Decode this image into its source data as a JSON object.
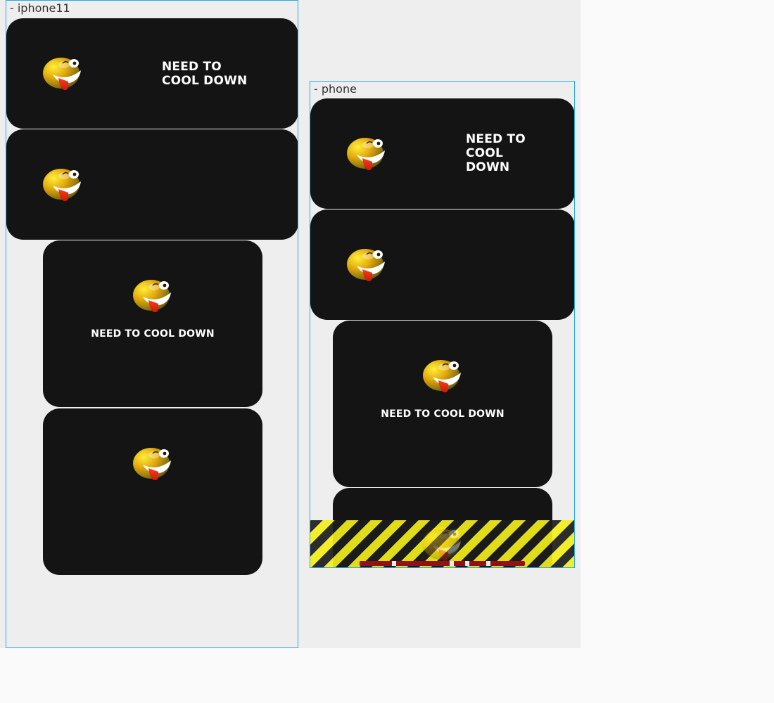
{
  "frames": {
    "iphone11": {
      "label": "- iphone11"
    },
    "phone": {
      "label": "- phone"
    }
  },
  "card_text": "NEED TO COOL DOWN",
  "emoji_icon": "crazy-face-emoji",
  "colors": {
    "card_bg": "#141414",
    "frame_border": "#29a9e0",
    "hazard_yellow": "#f2ee1a",
    "hazard_dark": "#1c1c1c",
    "overflow_bar": "#9b1212"
  },
  "overflow_warning": {
    "style": "hazard-stripes"
  }
}
